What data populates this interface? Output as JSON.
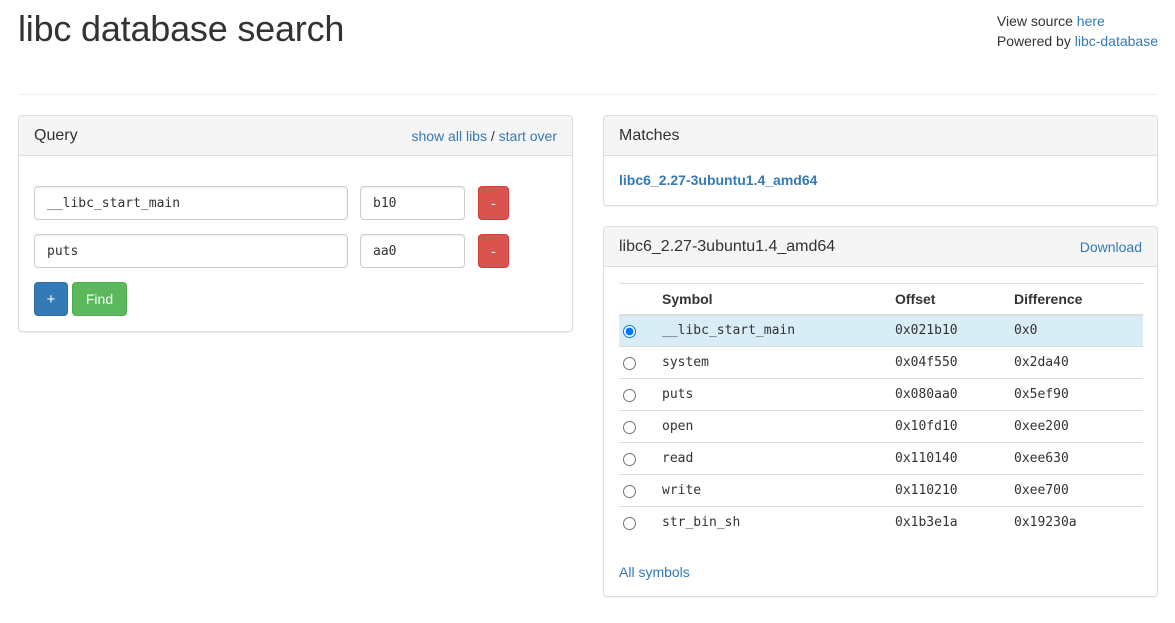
{
  "header": {
    "title": "libc database search",
    "view_source_prefix": "View source ",
    "view_source_link": "here",
    "powered_by_prefix": "Powered by ",
    "powered_by_link": "libc-database"
  },
  "query": {
    "title": "Query",
    "show_all_libs": "show all libs",
    "separator": " / ",
    "start_over": "start over",
    "rows": [
      {
        "symbol": "__libc_start_main",
        "address": "b10",
        "remove_label": "-"
      },
      {
        "symbol": "puts",
        "address": "aa0",
        "remove_label": "-"
      }
    ],
    "add_label": "+",
    "find_label": "Find"
  },
  "matches": {
    "title": "Matches",
    "items": [
      "libc6_2.27-3ubuntu1.4_amd64"
    ]
  },
  "detail": {
    "title": "libc6_2.27-3ubuntu1.4_amd64",
    "download": "Download",
    "columns": [
      "Symbol",
      "Offset",
      "Difference"
    ],
    "rows": [
      {
        "symbol": "__libc_start_main",
        "offset": "0x021b10",
        "difference": "0x0",
        "selected": true
      },
      {
        "symbol": "system",
        "offset": "0x04f550",
        "difference": "0x2da40",
        "selected": false
      },
      {
        "symbol": "puts",
        "offset": "0x080aa0",
        "difference": "0x5ef90",
        "selected": false
      },
      {
        "symbol": "open",
        "offset": "0x10fd10",
        "difference": "0xee200",
        "selected": false
      },
      {
        "symbol": "read",
        "offset": "0x110140",
        "difference": "0xee630",
        "selected": false
      },
      {
        "symbol": "write",
        "offset": "0x110210",
        "difference": "0xee700",
        "selected": false
      },
      {
        "symbol": "str_bin_sh",
        "offset": "0x1b3e1a",
        "difference": "0x19230a",
        "selected": false
      }
    ],
    "all_symbols": "All symbols"
  },
  "colors": {
    "link": "#337ab7",
    "danger": "#d9534f",
    "primary": "#337ab7",
    "success": "#5cb85c",
    "selected_row": "#d9edf7"
  }
}
